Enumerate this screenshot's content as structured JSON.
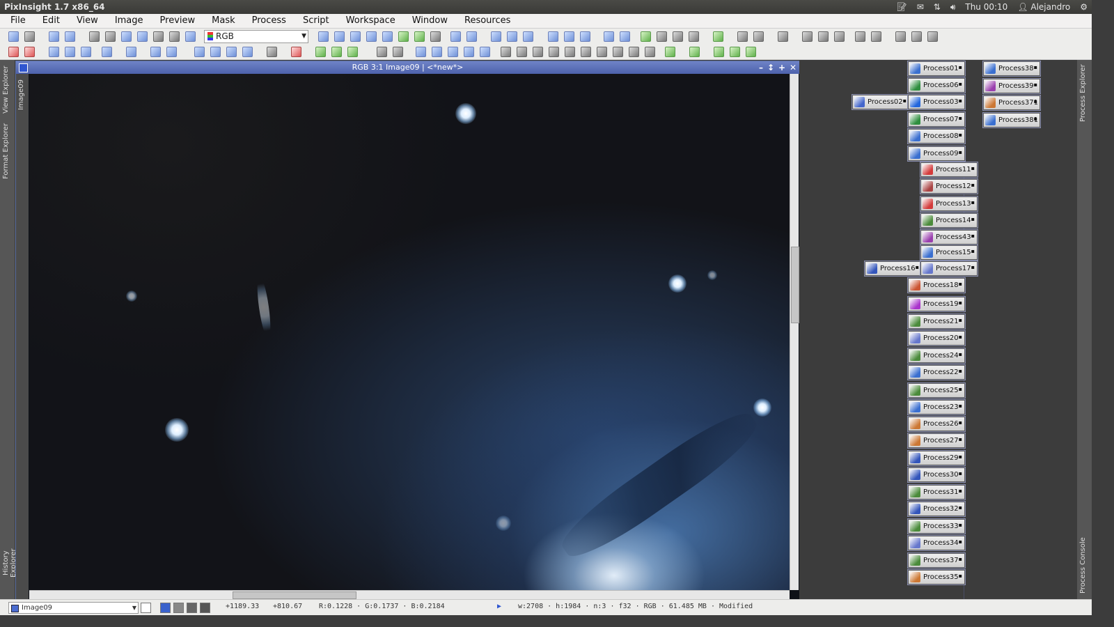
{
  "system_bar": {
    "app_title": "PixInsight 1.7 x86_64",
    "clock": "Thu 00:10",
    "user": "Alejandro"
  },
  "menu": [
    "File",
    "Edit",
    "View",
    "Image",
    "Preview",
    "Mask",
    "Process",
    "Script",
    "Workspace",
    "Window",
    "Resources"
  ],
  "toolbar": {
    "color_mode": "RGB"
  },
  "left_panel": {
    "view_explorer": "View Explorer",
    "format_explorer": "Format Explorer",
    "history_explorer": "History Explorer"
  },
  "image_window": {
    "title": "RGB 3:1 Image09 | <*new*>",
    "side_tab": "Image09"
  },
  "process_icons": [
    {
      "label": "Process01",
      "icon_color": "#3a6fd0"
    },
    {
      "label": "Process06",
      "icon_color": "#2f8f3f"
    },
    {
      "label": "Process02",
      "icon_color": "#4466cc"
    },
    {
      "label": "Process03",
      "icon_color": "#2266dd"
    },
    {
      "label": "Process07",
      "icon_color": "#2f8f3f"
    },
    {
      "label": "Process08",
      "icon_color": "#3a6fd0"
    },
    {
      "label": "Process09",
      "icon_color": "#3a6fd0"
    },
    {
      "label": "Process11",
      "icon_color": "#d43b3b"
    },
    {
      "label": "Process12",
      "icon_color": "#aa4444"
    },
    {
      "label": "Process13",
      "icon_color": "#d43b3b"
    },
    {
      "label": "Process14",
      "icon_color": "#4b8b3b"
    },
    {
      "label": "Process43",
      "icon_color": "#9a3fae"
    },
    {
      "label": "Process15",
      "icon_color": "#3a6fd0"
    },
    {
      "label": "Process16",
      "icon_color": "#3355bb"
    },
    {
      "label": "Process17",
      "icon_color": "#6677cc"
    },
    {
      "label": "Process18",
      "icon_color": "#cc5533"
    },
    {
      "label": "Process19",
      "icon_color": "#aa33cc"
    },
    {
      "label": "Process21",
      "icon_color": "#4b8b3b"
    },
    {
      "label": "Process20",
      "icon_color": "#6677cc"
    },
    {
      "label": "Process24",
      "icon_color": "#4b8b3b"
    },
    {
      "label": "Process22",
      "icon_color": "#3a6fd0"
    },
    {
      "label": "Process25",
      "icon_color": "#4b8b3b"
    },
    {
      "label": "Process23",
      "icon_color": "#3a6fd0"
    },
    {
      "label": "Process26",
      "icon_color": "#cc7733"
    },
    {
      "label": "Process27",
      "icon_color": "#cc7733"
    },
    {
      "label": "Process29",
      "icon_color": "#3355bb"
    },
    {
      "label": "Process30",
      "icon_color": "#3355bb"
    },
    {
      "label": "Process31",
      "icon_color": "#4b8b3b"
    },
    {
      "label": "Process32",
      "icon_color": "#3355bb"
    },
    {
      "label": "Process33",
      "icon_color": "#4b8b3b"
    },
    {
      "label": "Process34",
      "icon_color": "#6677cc"
    },
    {
      "label": "Process37",
      "icon_color": "#4b8b3b"
    },
    {
      "label": "Process35",
      "icon_color": "#cc7733"
    },
    {
      "label": "Process38",
      "icon_color": "#3a6fd0"
    },
    {
      "label": "Process39",
      "icon_color": "#9a3fae"
    },
    {
      "label": "Process371",
      "icon_color": "#cc7733"
    },
    {
      "label": "Process381",
      "icon_color": "#3a6fd0"
    }
  ],
  "right_panel": {
    "process_explorer": "Process Explorer",
    "process_console": "Process Console"
  },
  "status_bar": {
    "view_selector": "Image09",
    "cursor_x": "+1189.33",
    "cursor_y": "+810.67",
    "pixel_values": "R:0.1228 · G:0.1737 · B:0.2184",
    "image_info": "w:2708 · h:1984 · n:3 · f32 · RGB · 61.485 MB · Modified"
  }
}
